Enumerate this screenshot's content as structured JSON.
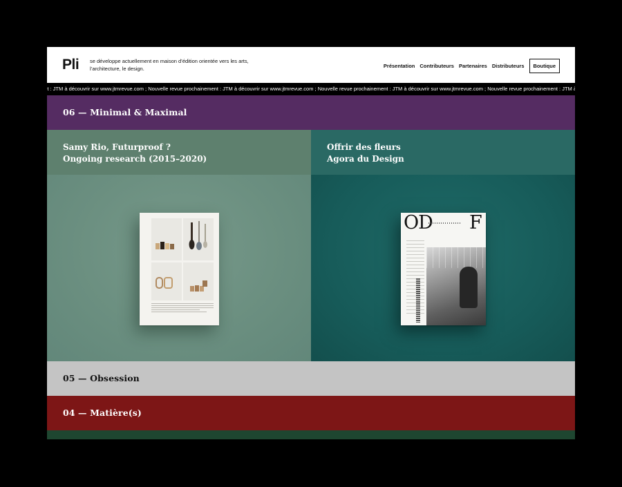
{
  "header": {
    "logo": "Pli",
    "tagline": "se développe actuellement en maison d’édition orientée vers les arts, l’architecture, le design.",
    "nav": {
      "presentation": "Présentation",
      "contributors": "Contributeurs",
      "partners": "Partenaires",
      "distributors": "Distributeurs",
      "shop": "Boutique"
    }
  },
  "ticker": "ent : JTM à découvrir sur www.jtmrevue.com ; Nouvelle revue prochainement : JTM à découvrir sur www.jtmrevue.com ; Nouvelle revue prochainement : JTM à découvrir sur www.jtmrevue.com ; Nouvelle revue prochainement : JTM à découvrir sur www.jtmrevue.com ; Nouvelle revue prochainem",
  "issues": {
    "i06": "06 — Minimal & Maximal",
    "i05": "05 — Obsession",
    "i04": "04 — Matière(s)"
  },
  "projects": {
    "left": {
      "line1": "Samy Rio, Futurproof ?",
      "line2": "Ongoing research (2015–2020)"
    },
    "right": {
      "line1": "Offrir des fleurs",
      "line2": "Agora du Design",
      "cover_od": "OD",
      "cover_f": "F"
    }
  },
  "colors": {
    "band_06": "#552c62",
    "band_05": "#c4c4c4",
    "band_04": "#7d1616",
    "card_left": "#5e806e",
    "card_right": "#2a6964"
  }
}
